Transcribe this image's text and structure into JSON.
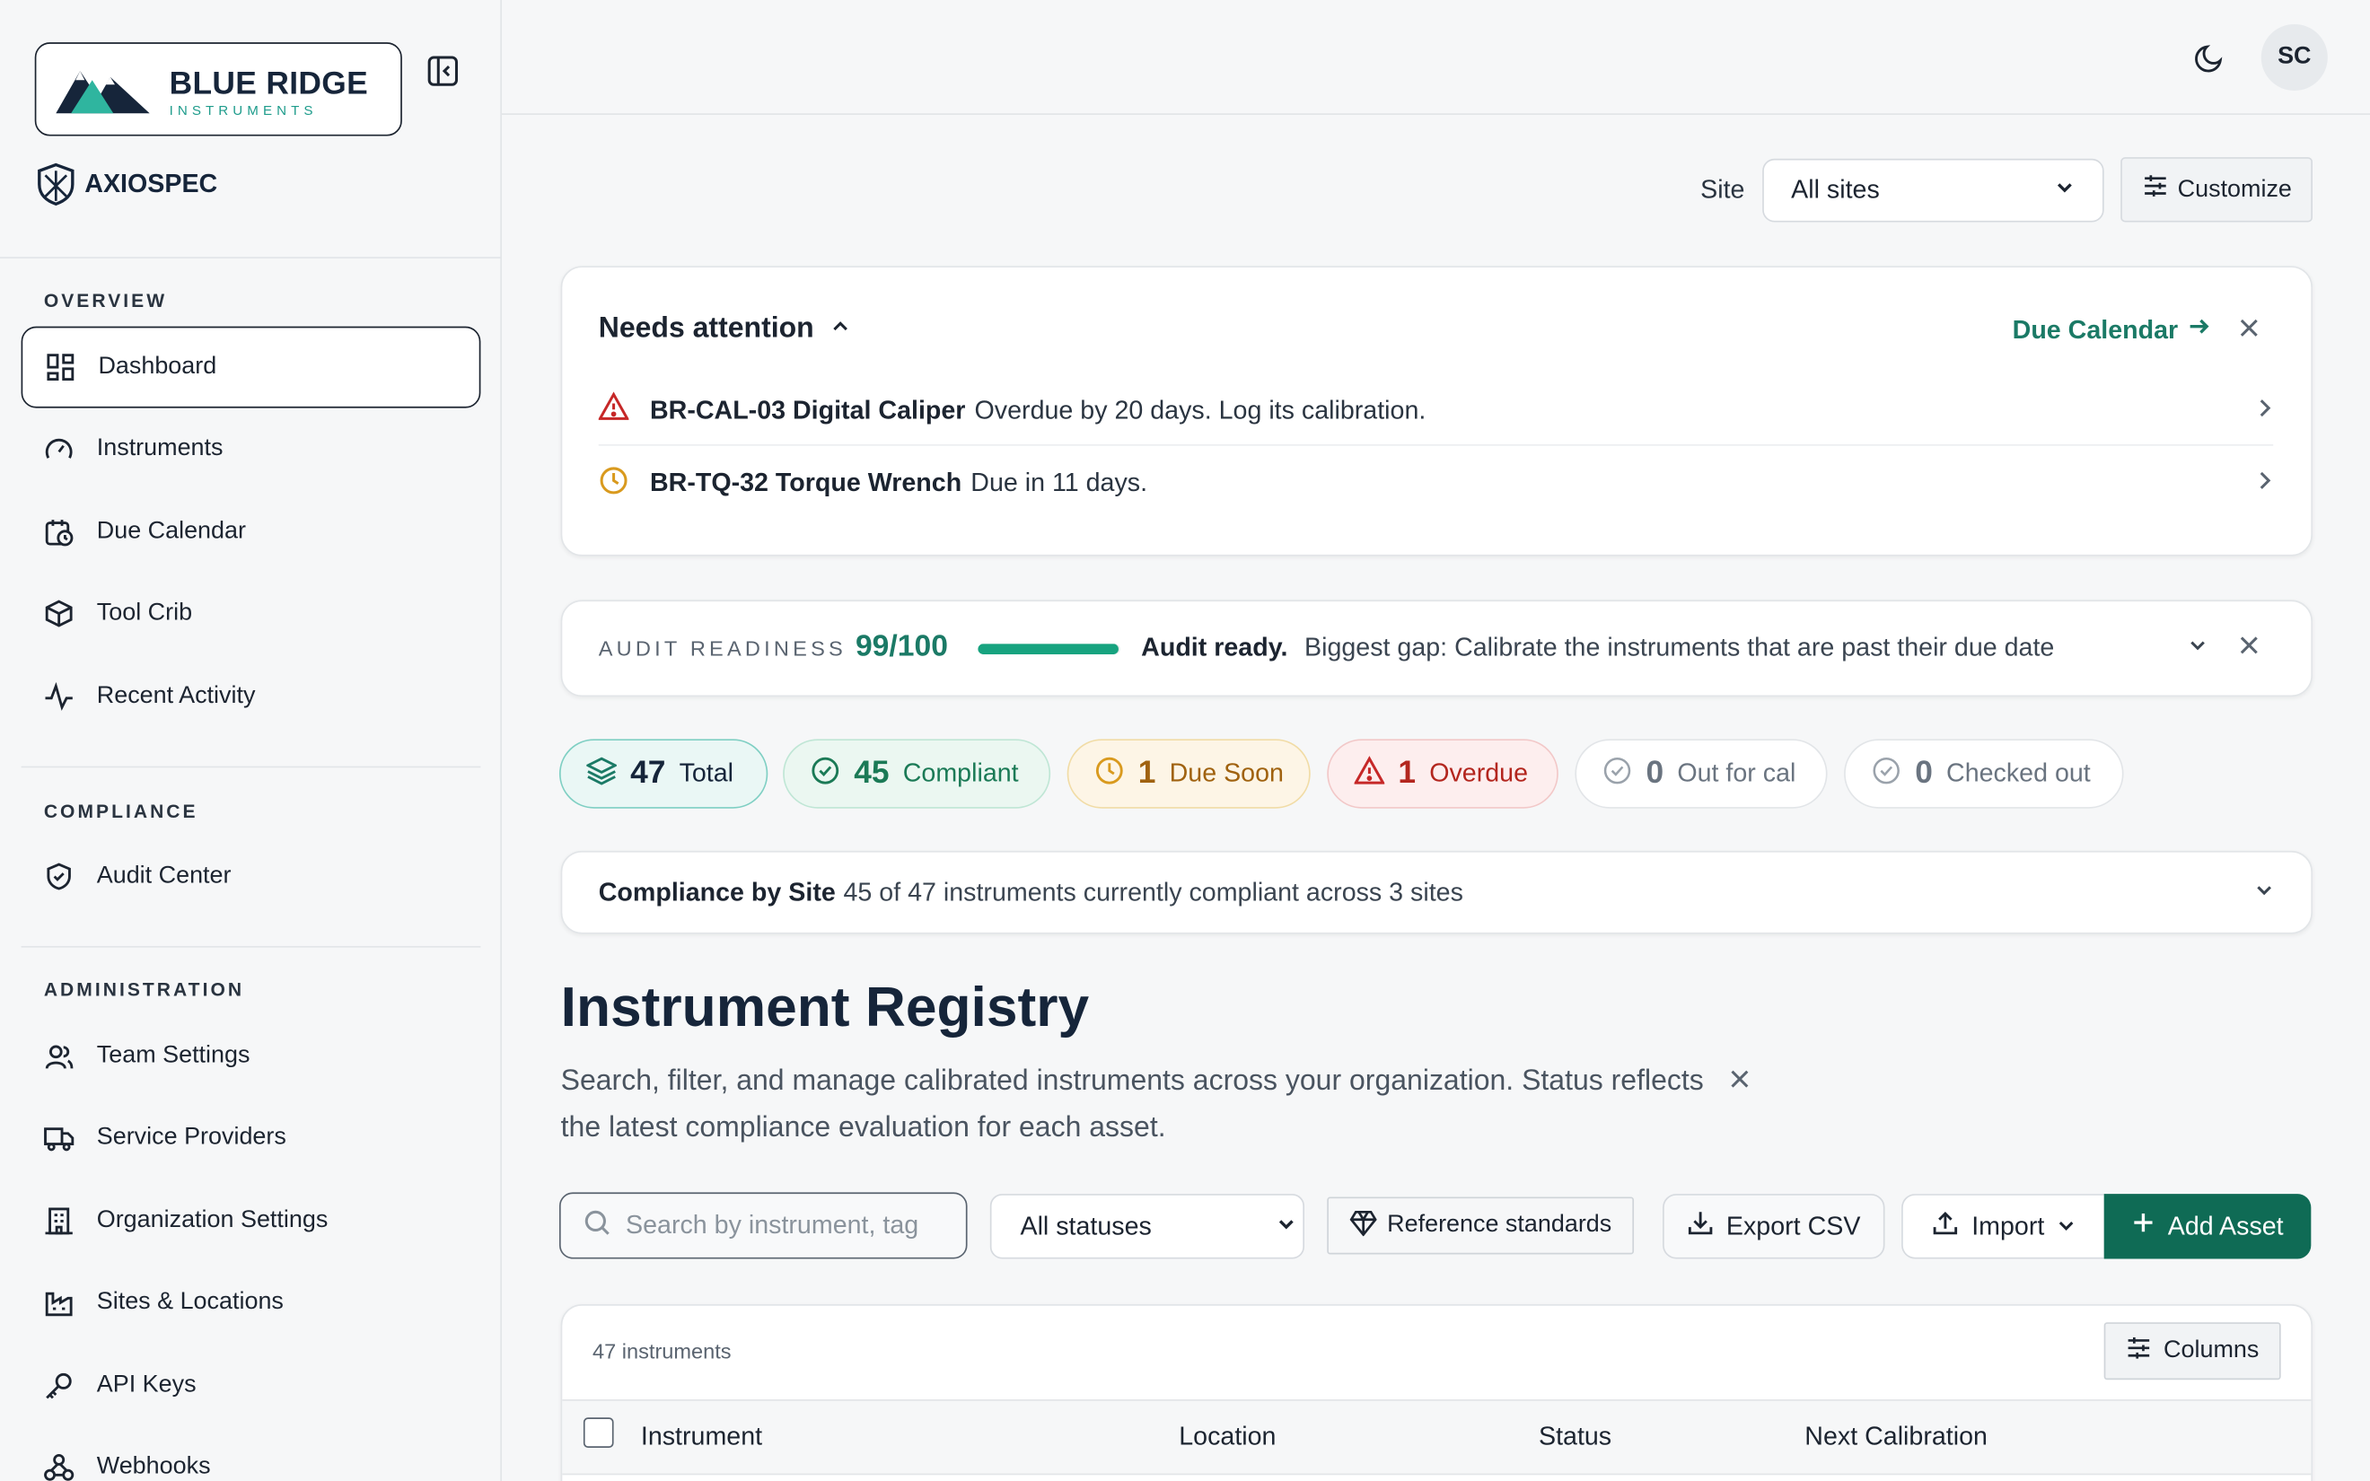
{
  "brand": {
    "logo_main": "BLUE RIDGE",
    "logo_sub": "INSTRUMENTS",
    "product": "AXIOSPEC"
  },
  "sidebar": {
    "sections": [
      {
        "label": "OVERVIEW",
        "items": [
          {
            "label": "Dashboard",
            "icon": "grid-icon",
            "active": true
          },
          {
            "label": "Instruments",
            "icon": "gauge-icon"
          },
          {
            "label": "Due Calendar",
            "icon": "calendar-clock-icon"
          },
          {
            "label": "Tool Crib",
            "icon": "box-icon"
          },
          {
            "label": "Recent Activity",
            "icon": "activity-icon"
          }
        ]
      },
      {
        "label": "COMPLIANCE",
        "items": [
          {
            "label": "Audit Center",
            "icon": "shield-check-icon"
          }
        ]
      },
      {
        "label": "ADMINISTRATION",
        "items": [
          {
            "label": "Team Settings",
            "icon": "users-icon"
          },
          {
            "label": "Service Providers",
            "icon": "truck-icon"
          },
          {
            "label": "Organization Settings",
            "icon": "building-icon"
          },
          {
            "label": "Sites & Locations",
            "icon": "factory-icon"
          },
          {
            "label": "API Keys",
            "icon": "key-icon"
          },
          {
            "label": "Webhooks",
            "icon": "webhook-icon"
          }
        ]
      }
    ]
  },
  "topbar": {
    "avatar_initials": "SC"
  },
  "site_filter": {
    "label": "Site",
    "value": "All sites",
    "customize_label": "Customize"
  },
  "attention": {
    "title": "Needs attention",
    "link": "Due Calendar",
    "items": [
      {
        "name": "BR-CAL-03 Digital Caliper",
        "detail": "Overdue by 20 days. Log its calibration.",
        "severity": "overdue"
      },
      {
        "name": "BR-TQ-32 Torque Wrench",
        "detail": "Due in 11 days.",
        "severity": "due-soon"
      }
    ]
  },
  "audit": {
    "label": "AUDIT READINESS",
    "score": "99/100",
    "score_fraction": 0.99,
    "status": "Audit ready.",
    "gap": "Biggest gap: Calibrate the instruments that are past their due date"
  },
  "stats": [
    {
      "value": "47",
      "label": "Total"
    },
    {
      "value": "45",
      "label": "Compliant"
    },
    {
      "value": "1",
      "label": "Due Soon"
    },
    {
      "value": "1",
      "label": "Overdue"
    },
    {
      "value": "0",
      "label": "Out for cal"
    },
    {
      "value": "0",
      "label": "Checked out"
    }
  ],
  "compliance_by_site": {
    "title": "Compliance by Site",
    "summary": "45 of 47 instruments currently compliant across 3 sites"
  },
  "registry": {
    "title": "Instrument Registry",
    "description": "Search, filter, and manage calibrated instruments across your organization. Status reflects the latest compliance evaluation for each asset.",
    "search_placeholder": "Search by instrument, tag",
    "status_filter": "All statuses",
    "reference_label": "Reference standards",
    "export_label": "Export CSV",
    "import_label": "Import",
    "add_label": "Add Asset",
    "count_label": "47 instruments",
    "columns_label": "Columns",
    "headers": [
      "Instrument",
      "Location",
      "Status",
      "Next Calibration"
    ]
  },
  "colors": {
    "accent": "#0f6b55",
    "compliant": "#1b7a56",
    "due_soon": "#a0620f",
    "overdue": "#b3261e"
  }
}
